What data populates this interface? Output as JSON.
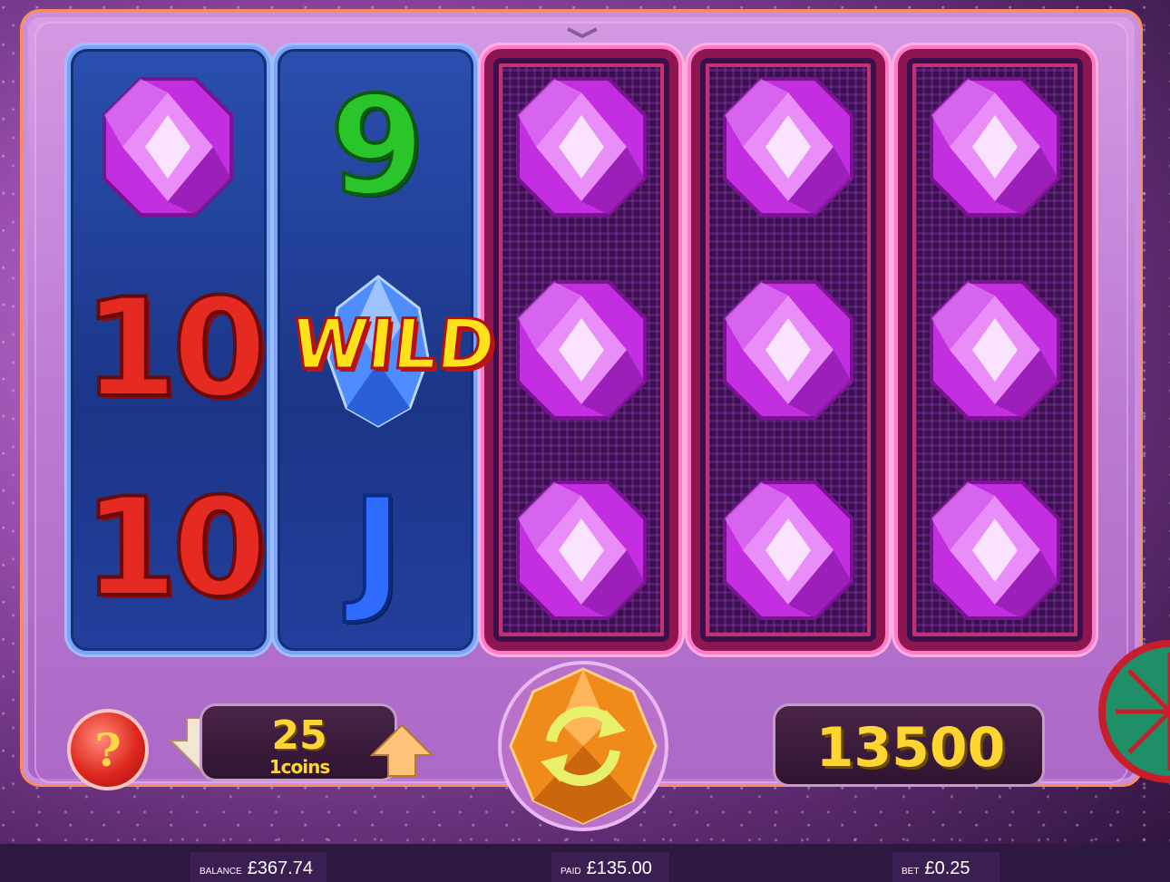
{
  "reels": [
    {
      "style": "blue",
      "symbols": [
        "purple-gem",
        "10",
        "10"
      ]
    },
    {
      "style": "blue",
      "symbols": [
        "9",
        "WILD",
        "J"
      ]
    },
    {
      "style": "neon",
      "symbols": [
        "purple-gem",
        "purple-gem",
        "purple-gem"
      ]
    },
    {
      "style": "neon",
      "symbols": [
        "purple-gem",
        "purple-gem",
        "purple-gem"
      ]
    },
    {
      "style": "neon",
      "symbols": [
        "purple-gem",
        "purple-gem",
        "purple-gem"
      ]
    }
  ],
  "symbols": {
    "ten": "10",
    "nine": "9",
    "jack": "J",
    "wild": "WILD"
  },
  "controls": {
    "help": "?",
    "lines": "25",
    "coins": "1coins",
    "win": "13500"
  },
  "status": {
    "balance_label": "BALANCE",
    "balance_value": "£367.74",
    "paid_label": "PAID",
    "paid_value": "£135.00",
    "bet_label": "BET",
    "bet_value": "£0.25"
  },
  "colors": {
    "gem": "#c22ee0",
    "accent": "#ffd531",
    "blue_reel": "#1b3587",
    "neon_reel": "#3a0f4e"
  }
}
